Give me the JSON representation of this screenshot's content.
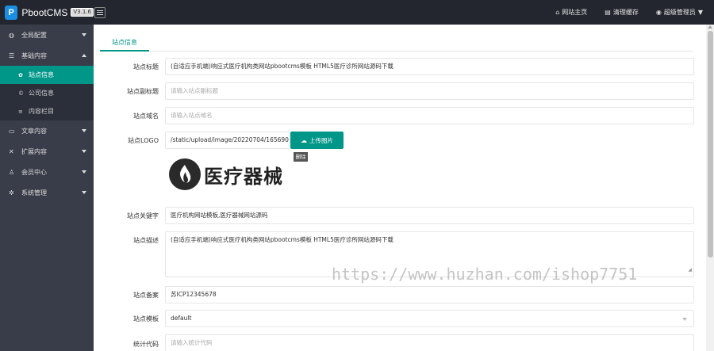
{
  "app": {
    "name": "PbootCMS",
    "version": "V3.1.6"
  },
  "header": {
    "links": [
      {
        "icon": "home-icon",
        "glyph": "⌂",
        "label": "网站主页"
      },
      {
        "icon": "trash-icon",
        "glyph": "▤",
        "label": "清理缓存"
      },
      {
        "icon": "user-icon",
        "glyph": "◉",
        "label": "超级管理员"
      }
    ]
  },
  "sidebar": {
    "items": [
      {
        "label": "全局配置"
      },
      {
        "label": "基础内容"
      },
      {
        "label": "文章内容"
      },
      {
        "label": "扩展内容"
      },
      {
        "label": "会员中心"
      },
      {
        "label": "系统管理"
      }
    ],
    "sub_items": [
      {
        "label": "站点信息"
      },
      {
        "label": "公司信息"
      },
      {
        "label": "内容栏目"
      }
    ]
  },
  "main": {
    "tab": "站点信息",
    "form": {
      "title": {
        "label": "站点标题",
        "value": "(自适应手机端)响应式医疗机构类网站pbootcms模板 HTML5医疗诊所网站源码下载"
      },
      "subtitle": {
        "label": "站点副标题",
        "placeholder": "请输入站点副标题"
      },
      "domain": {
        "label": "站点域名",
        "placeholder": "请输入站点域名"
      },
      "logo": {
        "label": "站点LOGO",
        "value": "/static/upload/image/20220704/1656900",
        "upload_label": "上传图片",
        "preview_text": "医疗器械",
        "delete_label": "删除"
      },
      "keywords": {
        "label": "站点关键字",
        "value": "医疗机构网站模板,医疗器械网站源码"
      },
      "description": {
        "label": "站点描述",
        "value": "(自适应手机端)响应式医疗机构类网站pbootcms模板 HTML5医疗诊所网站源码下载"
      },
      "icp": {
        "label": "站点备案",
        "value": "苏ICP12345678"
      },
      "template": {
        "label": "站点模板",
        "value": "default"
      },
      "stats": {
        "label": "统计代码",
        "placeholder": "请输入统计代码"
      }
    }
  },
  "watermark": "https://www.huzhan.com/ishop7751",
  "colors": {
    "accent": "#009688",
    "topbar": "#23262e",
    "sidebar": "#393d49"
  }
}
